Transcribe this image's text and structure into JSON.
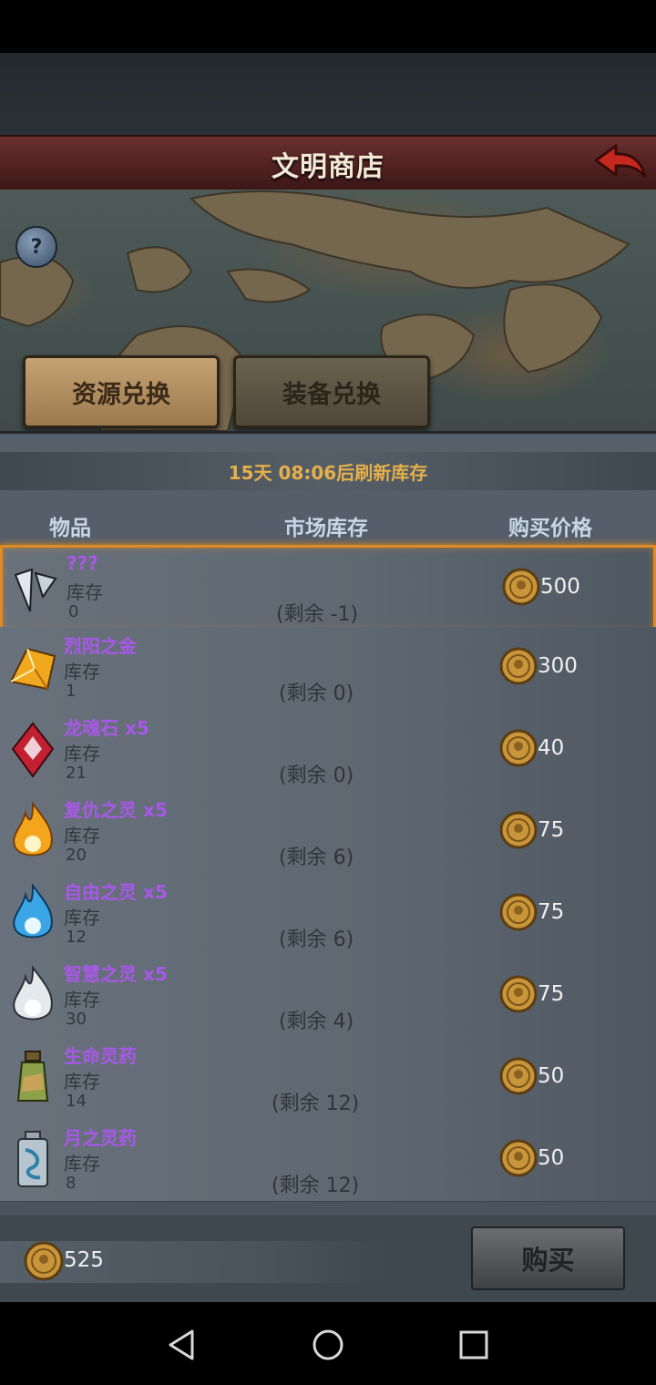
{
  "header": {
    "title": "文明商店"
  },
  "tabs": [
    {
      "label": "资源兑换",
      "active": true
    },
    {
      "label": "装备兑换",
      "active": false
    }
  ],
  "refresh_text": "15天 08:06后刷新库存",
  "columns": {
    "item": "物品",
    "market_stock": "市场库存",
    "price": "购买价格"
  },
  "items": [
    {
      "name": "???",
      "stock_label": "库存",
      "stock": "0",
      "remaining": "(剩余 -1)",
      "price": "500",
      "icon": "crystal-shards-icon",
      "selected": true
    },
    {
      "name": "烈阳之金",
      "stock_label": "库存",
      "stock": "1",
      "remaining": "(剩余 0)",
      "price": "300",
      "icon": "sun-gold-gem-icon",
      "selected": false
    },
    {
      "name": "龙魂石 x5",
      "stock_label": "库存",
      "stock": "21",
      "remaining": "(剩余 0)",
      "price": "40",
      "icon": "red-gem-icon",
      "selected": false
    },
    {
      "name": "复仇之灵 x5",
      "stock_label": "库存",
      "stock": "20",
      "remaining": "(剩余 6)",
      "price": "75",
      "icon": "orange-flame-icon",
      "selected": false
    },
    {
      "name": "自由之灵 x5",
      "stock_label": "库存",
      "stock": "12",
      "remaining": "(剩余 6)",
      "price": "75",
      "icon": "blue-flame-icon",
      "selected": false
    },
    {
      "name": "智慧之灵 x5",
      "stock_label": "库存",
      "stock": "30",
      "remaining": "(剩余 4)",
      "price": "75",
      "icon": "white-flame-icon",
      "selected": false
    },
    {
      "name": "生命灵药",
      "stock_label": "库存",
      "stock": "14",
      "remaining": "(剩余 12)",
      "price": "50",
      "icon": "green-potion-icon",
      "selected": false
    },
    {
      "name": "月之灵药",
      "stock_label": "库存",
      "stock": "8",
      "remaining": "(剩余 12)",
      "price": "50",
      "icon": "blue-potion-icon",
      "selected": false
    }
  ],
  "wallet": {
    "amount": "525"
  },
  "buy_button": "购买",
  "colors": {
    "item_name": "#a858e8",
    "selected_border": "#e08b22",
    "refresh_text": "#e6b04a"
  }
}
